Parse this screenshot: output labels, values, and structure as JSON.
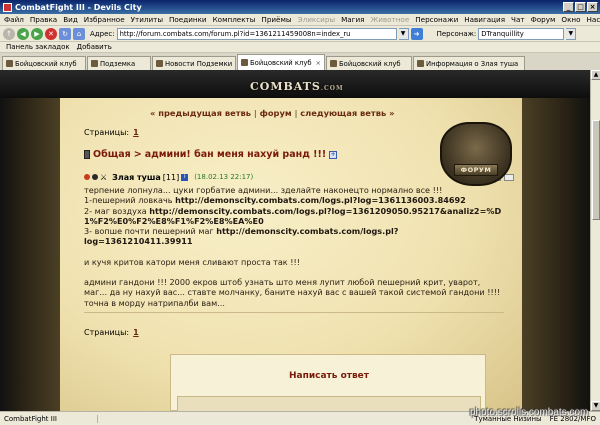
{
  "window": {
    "title": "CombatFight III - Devils City"
  },
  "menubar": {
    "items": [
      {
        "label": "Файл",
        "disabled": false
      },
      {
        "label": "Правка",
        "disabled": false
      },
      {
        "label": "Вид",
        "disabled": false
      },
      {
        "label": "Избранное",
        "disabled": false
      },
      {
        "label": "Утилиты",
        "disabled": false
      },
      {
        "label": "Поединки",
        "disabled": false
      },
      {
        "label": "Комплекты",
        "disabled": false
      },
      {
        "label": "Приёмы",
        "disabled": false
      },
      {
        "label": "Эликсиры",
        "disabled": true
      },
      {
        "label": "Магия",
        "disabled": false
      },
      {
        "label": "Животное",
        "disabled": true
      },
      {
        "label": "Персонажи",
        "disabled": false
      },
      {
        "label": "Навигация",
        "disabled": false
      },
      {
        "label": "Чат",
        "disabled": false
      },
      {
        "label": "Форум",
        "disabled": false
      },
      {
        "label": "Окно",
        "disabled": false
      },
      {
        "label": "Настройки",
        "disabled": false
      }
    ]
  },
  "toolbar": {
    "address_label": "Адрес:",
    "address_value": "http://forum.combats.com/forum.pl?id=1361211459008n=index_ru",
    "persona_label": "Персонаж:",
    "persona_value": "DTranquillity"
  },
  "bookmarks": {
    "items": [
      "Панель закладок",
      "Добавить"
    ]
  },
  "tabs": [
    {
      "label": "Бойцовский клуб",
      "active": false
    },
    {
      "label": "Подземка",
      "active": false
    },
    {
      "label": "Новости Подземки",
      "active": false
    },
    {
      "label": "Бойцовский клуб",
      "active": true
    },
    {
      "label": "Бойцовский клуб",
      "active": false
    },
    {
      "label": "Информация о Злая туша",
      "active": false
    }
  ],
  "site": {
    "logo": "COMBATS",
    "logo_suffix": ".COM",
    "forum_badge": "ФОРУМ"
  },
  "post_nav": {
    "prev": "« предыдущая ветвь",
    "sep": "|",
    "forum": "форум",
    "next": "следующая ветвь »"
  },
  "pagination": {
    "label": "Страницы:",
    "page": "1"
  },
  "thread": {
    "category": "Общая",
    "arrow": ">",
    "title": "админи! бан меня нахуй ранд !!!"
  },
  "post": {
    "author": "Злая туша",
    "level": "[11]",
    "date": "(18.02.13 22:17)",
    "lines": [
      {
        "text": "терпение лопнула... цуки горбатие админи... зделайте наконецто нормално все !!!"
      },
      {
        "text": "1-пешерний ловкачь ",
        "link": "http://demonscity.combats.com/logs.pl?log=1361136003.84692"
      },
      {
        "text": "2- маг воздуха ",
        "link": "http://demonscity.combats.com/logs.pl?log=1361209050.95217&analiz2=%D1%F2%E0%F2%E8%F1%F2%E8%EA%E0"
      },
      {
        "text": "3- вопше почти пешерний маг ",
        "link": "http://demonscity.combats.com/logs.pl?log=1361210411.39911"
      },
      {
        "text": ""
      },
      {
        "text": "и кучя критов катори меня сливают проста так !!!"
      },
      {
        "text": ""
      },
      {
        "text": "админи гандони !!! 2000 екров штоб узнать што меня лупит любой пешерний крит, уварот, маг... да ну нахуй вас... ставте молчанку, баните нахуй вас с вашей такой системой гандони !!!! точна в морду натрипалби вам..."
      }
    ]
  },
  "reply": {
    "title": "Написать ответ"
  },
  "statusbar": {
    "app": "CombatFight III",
    "weather": "Туманные Низины",
    "mem": "FE 2802/MFO"
  },
  "watermark": "photo.scrolls.combats.com",
  "colors": {
    "accent": "#7a1a0a",
    "link": "#6b2a10",
    "date": "#2a7a2a"
  }
}
